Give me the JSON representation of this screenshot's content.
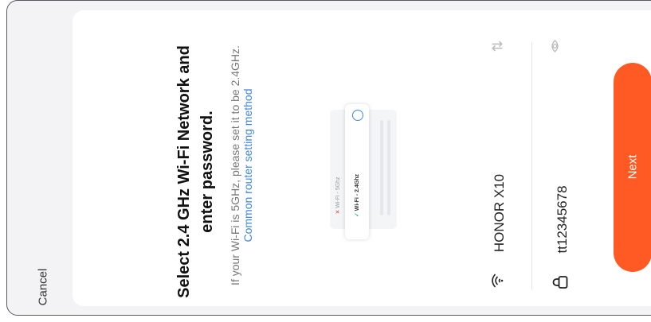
{
  "header": {
    "cancel_label": "Cancel"
  },
  "main": {
    "title": "Select 2.4 GHz Wi-Fi Network and enter password.",
    "note_text": "If your Wi-Fi is 5GHz, please set it to be 2.4GHz. ",
    "note_link": "Common router setting method"
  },
  "illustration": {
    "option_5g": "Wi-Fi - 5Ghz",
    "option_24g": "Wi-Fi - 2.4Ghz"
  },
  "form": {
    "ssid_value": "HONOR X10",
    "password_value": "tt12345678",
    "icons": {
      "wifi": "wifi-icon",
      "swap": "swap-icon",
      "lock": "lock-icon",
      "eye": "eye-icon"
    }
  },
  "actions": {
    "next_label": "Next"
  },
  "colors": {
    "accent": "#ff5a24",
    "link": "#3f86e0"
  }
}
